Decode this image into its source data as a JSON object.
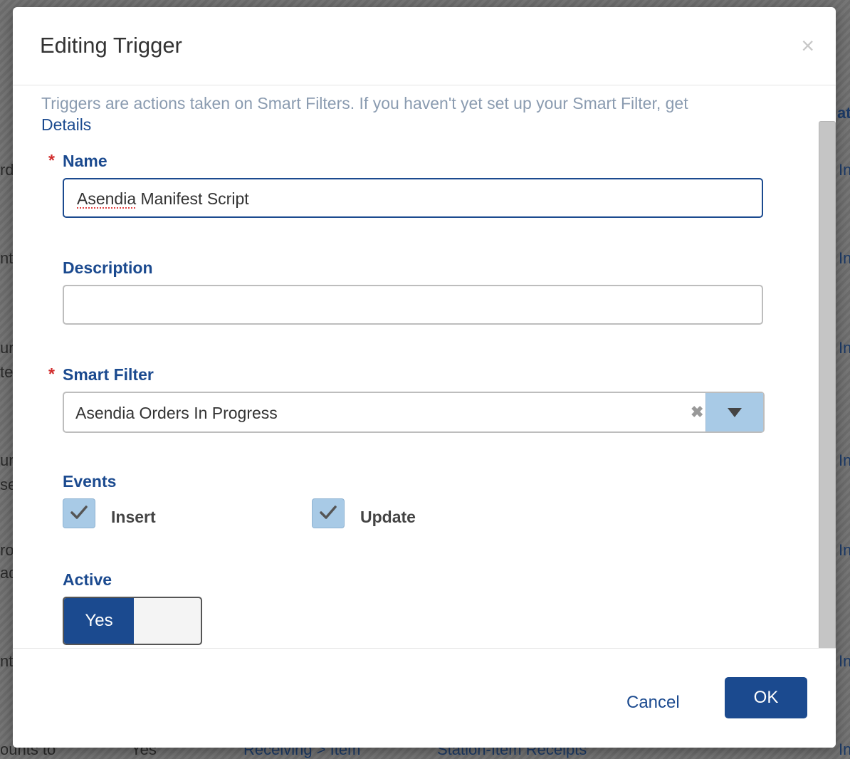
{
  "background": {
    "rows_left": [
      "rd",
      "nt",
      "ur",
      "te",
      "ur",
      "se",
      "ro",
      "ad",
      "nt",
      "ounts to"
    ],
    "rows_right": [
      "In",
      "In",
      "In",
      "In",
      "In",
      "In",
      "In"
    ],
    "header_right": "ate",
    "bottom_row": {
      "col2": "Yes",
      "col3": "Receiving > Item",
      "col4": "Station-Item Receipts"
    }
  },
  "modal": {
    "title": "Editing Trigger",
    "close_glyph": "×",
    "intro_text": "Triggers are actions taken on Smart Filters. If you haven't yet set up your Smart Filter, get",
    "details_link": "Details",
    "fields": {
      "name": {
        "label": "Name",
        "required_mark": "*",
        "value_word1": "Asendia",
        "value_rest": " Manifest Script"
      },
      "description": {
        "label": "Description",
        "value": ""
      },
      "smart_filter": {
        "label": "Smart Filter",
        "required_mark": "*",
        "value": "Asendia Orders In Progress",
        "clear_glyph": "✖"
      },
      "events": {
        "label": "Events",
        "options": [
          {
            "label": "Insert",
            "checked": true
          },
          {
            "label": "Update",
            "checked": true
          }
        ]
      },
      "active": {
        "label": "Active",
        "yes_label": "Yes",
        "value": true
      }
    },
    "footer": {
      "cancel_label": "Cancel",
      "ok_label": "OK"
    }
  },
  "colors": {
    "primary": "#1b4a8f",
    "checkbox_bg": "#a8cae6",
    "required": "#d12b2b",
    "intro_text": "#8a9bb0"
  }
}
